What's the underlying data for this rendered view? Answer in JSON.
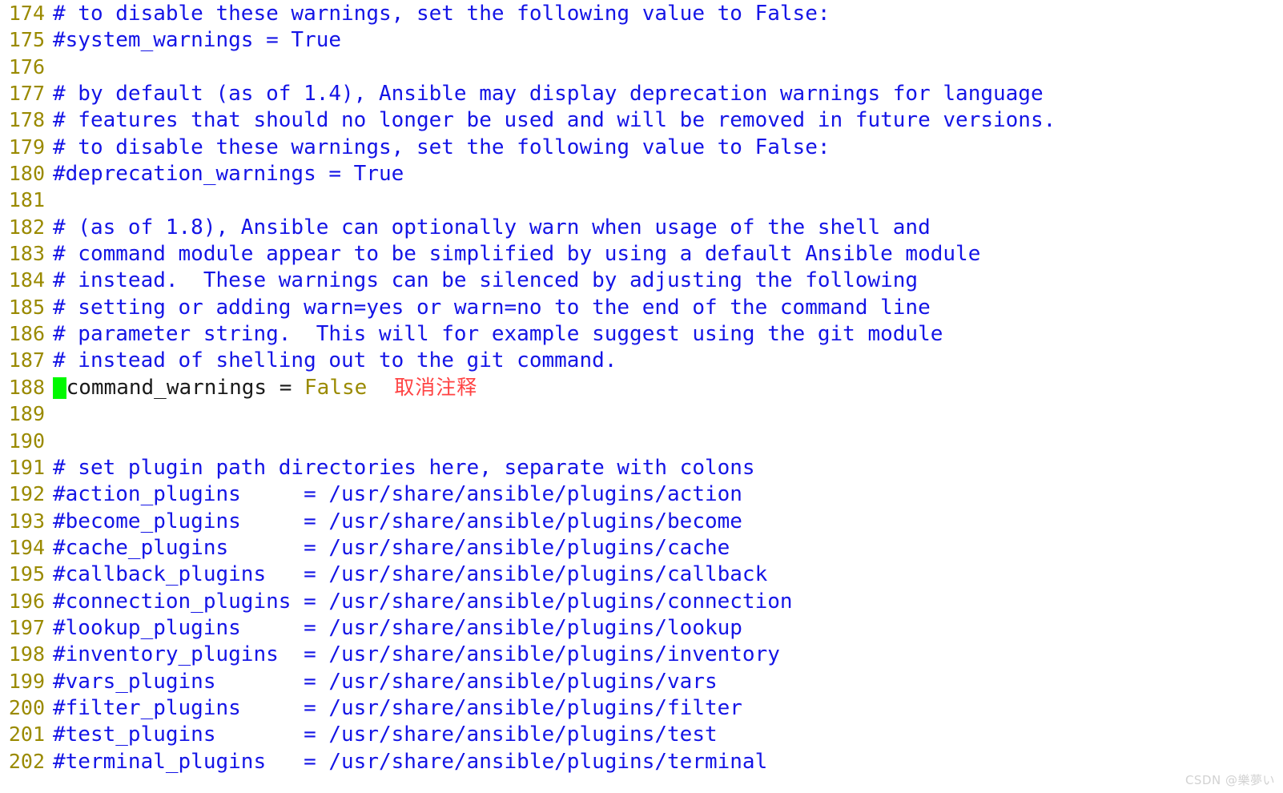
{
  "editor": {
    "kind": "vim-text-editor",
    "file_type": "ansible-configuration",
    "gutter_color": "#9a8a00",
    "comment_color": "#1414e6",
    "plain_color": "#1a1a1a",
    "constant_color": "#9a8a00",
    "cursor_color": "#00f900",
    "annotation_color": "#ff4343",
    "background_color": "#ffffff"
  },
  "annotation": {
    "text": "取消注释",
    "on_line": "188"
  },
  "watermark": {
    "text": "CSDN @樂夢い"
  },
  "lines": [
    {
      "no": "174",
      "type": "comment",
      "text": "# to disable these warnings, set the following value to False:"
    },
    {
      "no": "175",
      "type": "comment",
      "text": "#system_warnings = True"
    },
    {
      "no": "176",
      "type": "blank",
      "text": ""
    },
    {
      "no": "177",
      "type": "comment",
      "text": "# by default (as of 1.4), Ansible may display deprecation warnings for language"
    },
    {
      "no": "178",
      "type": "comment",
      "text": "# features that should no longer be used and will be removed in future versions."
    },
    {
      "no": "179",
      "type": "comment",
      "text": "# to disable these warnings, set the following value to False:"
    },
    {
      "no": "180",
      "type": "comment",
      "text": "#deprecation_warnings = True"
    },
    {
      "no": "181",
      "type": "blank",
      "text": ""
    },
    {
      "no": "182",
      "type": "comment",
      "text": "# (as of 1.8), Ansible can optionally warn when usage of the shell and"
    },
    {
      "no": "183",
      "type": "comment",
      "text": "# command module appear to be simplified by using a default Ansible module"
    },
    {
      "no": "184",
      "type": "comment",
      "text": "# instead.  These warnings can be silenced by adjusting the following"
    },
    {
      "no": "185",
      "type": "comment",
      "text": "# setting or adding warn=yes or warn=no to the end of the command line"
    },
    {
      "no": "186",
      "type": "comment",
      "text": "# parameter string.  This will for example suggest using the git module"
    },
    {
      "no": "187",
      "type": "comment",
      "text": "# instead of shelling out to the git command."
    },
    {
      "no": "188",
      "type": "active",
      "cursor": true,
      "plain": "command_warnings = ",
      "const": "False",
      "annotation": "取消注释",
      "text": "command_warnings = False"
    },
    {
      "no": "189",
      "type": "blank",
      "text": ""
    },
    {
      "no": "190",
      "type": "blank",
      "text": ""
    },
    {
      "no": "191",
      "type": "comment",
      "text": "# set plugin path directories here, separate with colons"
    },
    {
      "no": "192",
      "type": "comment",
      "text": "#action_plugins     = /usr/share/ansible/plugins/action"
    },
    {
      "no": "193",
      "type": "comment",
      "text": "#become_plugins     = /usr/share/ansible/plugins/become"
    },
    {
      "no": "194",
      "type": "comment",
      "text": "#cache_plugins      = /usr/share/ansible/plugins/cache"
    },
    {
      "no": "195",
      "type": "comment",
      "text": "#callback_plugins   = /usr/share/ansible/plugins/callback"
    },
    {
      "no": "196",
      "type": "comment",
      "text": "#connection_plugins = /usr/share/ansible/plugins/connection"
    },
    {
      "no": "197",
      "type": "comment",
      "text": "#lookup_plugins     = /usr/share/ansible/plugins/lookup"
    },
    {
      "no": "198",
      "type": "comment",
      "text": "#inventory_plugins  = /usr/share/ansible/plugins/inventory"
    },
    {
      "no": "199",
      "type": "comment",
      "text": "#vars_plugins       = /usr/share/ansible/plugins/vars"
    },
    {
      "no": "200",
      "type": "comment",
      "text": "#filter_plugins     = /usr/share/ansible/plugins/filter"
    },
    {
      "no": "201",
      "type": "comment",
      "text": "#test_plugins       = /usr/share/ansible/plugins/test"
    },
    {
      "no": "202",
      "type": "comment",
      "text": "#terminal_plugins   = /usr/share/ansible/plugins/terminal"
    }
  ]
}
